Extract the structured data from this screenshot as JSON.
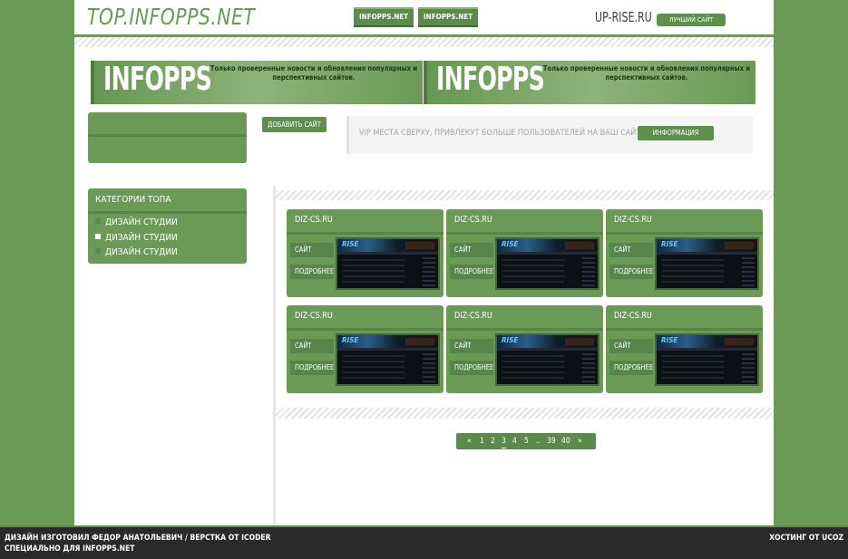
{
  "header": {
    "logo": "TOP.INFOPPS.NET",
    "tabs": [
      "INFOPPS.NET",
      "INFOPPS.NET"
    ],
    "partner_name": "UP-RISE.RU",
    "partner_button": "ЛУЧШИЙ САЙТ"
  },
  "banners": [
    {
      "logo": "INFOPPS",
      "text": "Только проверенные новости и обновления популярных и перспективных сайтов."
    },
    {
      "logo": "INFOPPS",
      "text": "Только проверенные новости и обновления популярных и перспективных сайтов."
    }
  ],
  "actions": {
    "add_site": "ДОБАВИТЬ САЙТ",
    "vip_text": "VIP МЕСТА СВЕРХУ, ПРИВЛЕКУТ БОЛЬШЕ ПОЛЬЗОВАТЕЛЕЙ НА ВАШ САЙТ",
    "vip_button": "ИНФОРМАЦИЯ"
  },
  "categories": {
    "title": "КАТЕГОРИИ ТОПА",
    "items": [
      {
        "label": "ДИЗАЙН СТУДИИ",
        "active": false
      },
      {
        "label": "ДИЗАЙН СТУДИИ",
        "active": true
      },
      {
        "label": "ДИЗАЙН СТУДИИ",
        "active": false
      }
    ]
  },
  "cards": {
    "site_label": "САЙТ",
    "more_label": "ПОДРОБНЕЕ",
    "thumb_logo": "RISE",
    "items": [
      {
        "title": "DIZ-CS.RU"
      },
      {
        "title": "DIZ-CS.RU"
      },
      {
        "title": "DIZ-CS.RU"
      },
      {
        "title": "DIZ-CS.RU"
      },
      {
        "title": "DIZ-CS.RU"
      },
      {
        "title": "DIZ-CS.RU"
      }
    ]
  },
  "pagination": {
    "prev": "«",
    "pages": [
      "1",
      "2",
      "3",
      "4",
      "5",
      "..",
      "39",
      "40"
    ],
    "current": "3",
    "next": "»"
  },
  "footer": {
    "line1": "ДИЗАЙН ИЗГОТОВИЛ ФЕДОР АНАТОЛЬЕВИЧ / ВЕРСТКА ОТ ICODER",
    "line2": "СПЕЦИАЛЬНО ДЛЯ INFOPPS.NET",
    "hosting": "ХОСТИНГ ОТ UCOZ"
  },
  "colors": {
    "accent": "#6a9a56",
    "accent_dark": "#58864a",
    "footer": "#2a2a2a"
  }
}
